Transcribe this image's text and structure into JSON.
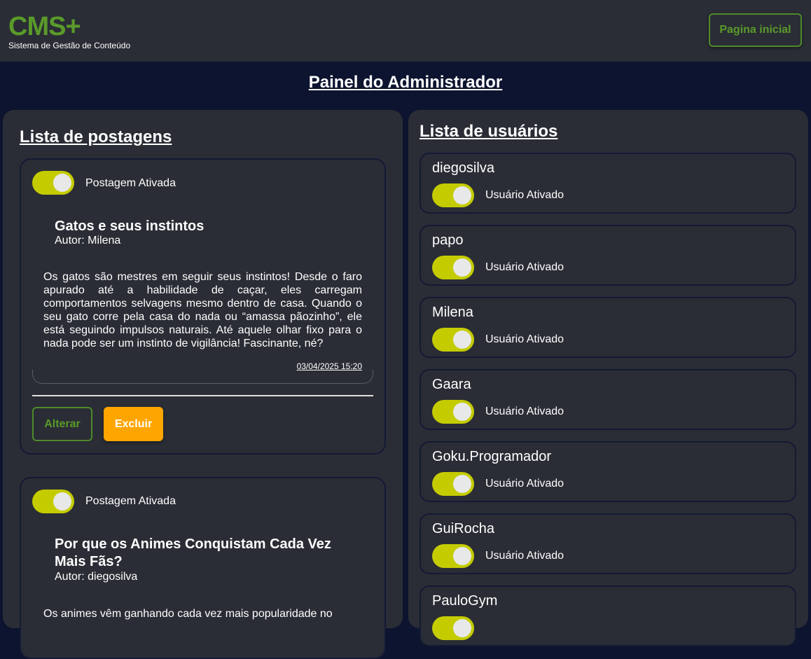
{
  "header": {
    "logo": "CMS+",
    "subtitle": "Sistema de Gestão de Conteúdo",
    "home_button": "Pagina inicial"
  },
  "page_title": "Painel do Administrador",
  "posts_section": {
    "title": "Lista de postagens",
    "posts": [
      {
        "status": "Postagem Ativada",
        "title": "Gatos e seus instintos",
        "author": "Autor: Milena",
        "body": "Os gatos são mestres em seguir seus instintos! Desde o faro apurado até a habilidade de caçar, eles carregam comportamentos selvagens mesmo dentro de casa. Quando o seu gato corre pela casa do nada ou “amassa pãozinho”, ele está seguindo impulsos naturais. Até aquele olhar fixo para o nada pode ser um instinto de vigilância! Fascinante, né?",
        "date": "03/04/2025 15:20",
        "edit_label": "Alterar",
        "delete_label": "Excluir"
      },
      {
        "status": "Postagem Ativada",
        "title": "Por que os Animes Conquistam Cada Vez Mais Fãs?",
        "author": "Autor: diegosilva",
        "body": "Os animes vêm ganhando cada vez mais popularidade no"
      }
    ]
  },
  "users_section": {
    "title": "Lista de usuários",
    "users": [
      {
        "name": "diegosilva",
        "status": "Usuário Ativado"
      },
      {
        "name": "papo",
        "status": "Usuário Ativado"
      },
      {
        "name": "Milena",
        "status": "Usuário Ativado"
      },
      {
        "name": "Gaara",
        "status": "Usuário Ativado"
      },
      {
        "name": "Goku.Programador",
        "status": "Usuário Ativado"
      },
      {
        "name": "GuiRocha",
        "status": "Usuário Ativado"
      },
      {
        "name": "PauloGym",
        "status": ""
      }
    ]
  },
  "colors": {
    "background": "#0c1430",
    "panel": "#2a2d35",
    "brand_green": "#5a9a2a",
    "toggle_on": "#c4cc00",
    "delete_orange": "#ffa500"
  }
}
